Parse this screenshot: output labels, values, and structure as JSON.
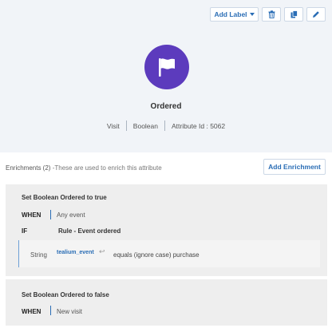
{
  "toolbar": {
    "add_label": "Add Label",
    "delete_icon": "trash-icon",
    "copy_icon": "copy-icon",
    "edit_icon": "pencil-icon"
  },
  "attribute": {
    "icon": "flag-icon",
    "icon_color": "#5c3bbd",
    "name": "Ordered",
    "scope": "Visit",
    "type": "Boolean",
    "id_text": "Attribute Id : 5062"
  },
  "enrichments": {
    "heading": "Enrichments (2)",
    "subheading": "-These are used to enrich this attribute",
    "add_button": "Add Enrichment",
    "items": [
      {
        "title": "Set Boolean Ordered to true",
        "when_label": "WHEN",
        "when_value": "Any event",
        "if_label": "IF",
        "rule": "Rule - Event ordered",
        "condition": {
          "type": "String",
          "attribute": "tealium_event",
          "operator_value": "equals (ignore case) purchase"
        }
      },
      {
        "title": "Set Boolean Ordered to false",
        "when_label": "WHEN",
        "when_value": "New visit"
      }
    ]
  },
  "colors": {
    "accent": "#2a6db5",
    "header_bg": "#f1f4f8",
    "card_bg": "#eeeeee"
  }
}
